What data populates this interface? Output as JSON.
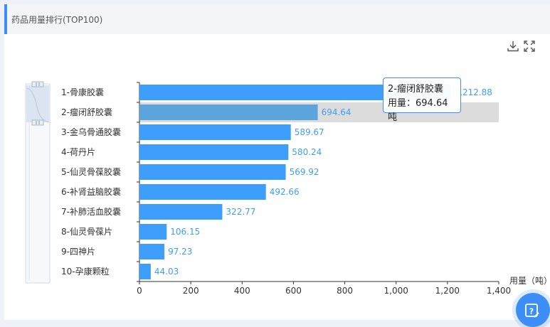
{
  "header": {
    "title": "药品用量排行(TOP100)"
  },
  "toolbar": {
    "download_icon": "download-icon",
    "fullscreen_icon": "fullscreen-icon"
  },
  "colors": {
    "bar": "#3e9efb",
    "bar_highlight": "#5ba5dc",
    "highlight_band": "#dcdcdc",
    "label": "#3e9efb",
    "accent": "#3e8ef7"
  },
  "tooltip": {
    "title": "2-瘤闭舒胶囊",
    "line": "用量：694.64吨"
  },
  "help_icon": "edit-help-icon",
  "chart_data": {
    "type": "bar",
    "orientation": "horizontal",
    "categories": [
      "1-骨康胶囊",
      "2-瘤闭舒胶囊",
      "3-金乌骨通胶囊",
      "4-荷丹片",
      "5-仙灵骨葆胶囊",
      "6-补肾益脑胶囊",
      "7-补肺活血胶囊",
      "8-仙灵骨葆片",
      "9-四神片",
      "10-孕康颗粒"
    ],
    "values": [
      1212.88,
      694.64,
      589.67,
      580.24,
      569.92,
      492.66,
      322.77,
      106.15,
      97.23,
      44.03
    ],
    "value_labels": [
      "1,212.88",
      "694.64",
      "589.67",
      "580.24",
      "569.92",
      "492.66",
      "322.77",
      "106.15",
      "97.23",
      "44.03"
    ],
    "xlabel": "用量（吨）",
    "xlim": [
      0,
      1400
    ],
    "xticks": [
      "0",
      "200",
      "400",
      "600",
      "800",
      "1,000",
      "1,200",
      "1,400"
    ],
    "highlighted_index": 1,
    "grid": false,
    "legend": "none"
  }
}
